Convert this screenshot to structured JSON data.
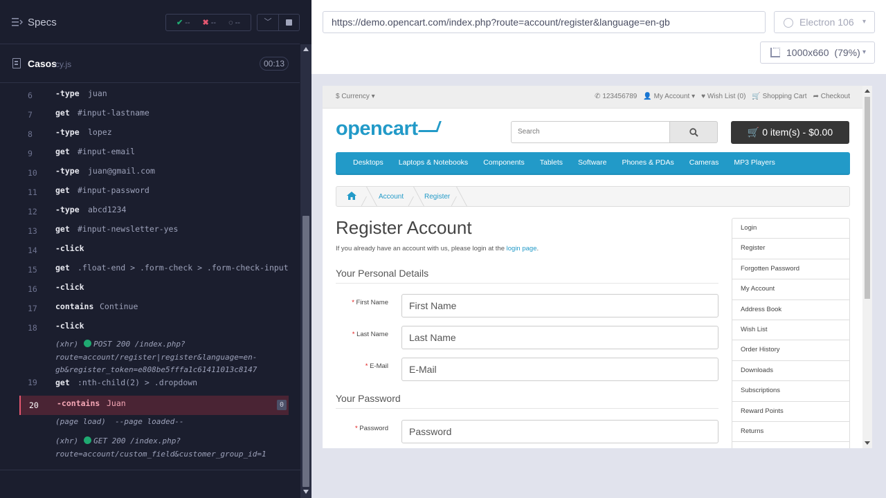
{
  "runner": {
    "specs_label": "Specs",
    "stats": {
      "passed": "--",
      "failed": "--",
      "pending": "--"
    },
    "spec_name": "Casos",
    "spec_ext": "cy.js",
    "timer": "00:13"
  },
  "log": [
    {
      "line": "6",
      "cmd": "-type",
      "arg": "juan"
    },
    {
      "line": "7",
      "cmd": "get",
      "arg": "#input-lastname"
    },
    {
      "line": "8",
      "cmd": "-type",
      "arg": "lopez"
    },
    {
      "line": "9",
      "cmd": "get",
      "arg": "#input-email"
    },
    {
      "line": "10",
      "cmd": "-type",
      "arg": "juan@gmail.com"
    },
    {
      "line": "11",
      "cmd": "get",
      "arg": "#input-password"
    },
    {
      "line": "12",
      "cmd": "-type",
      "arg": "abcd1234"
    },
    {
      "line": "13",
      "cmd": "get",
      "arg": "#input-newsletter-yes"
    },
    {
      "line": "14",
      "cmd": "-click",
      "arg": ""
    },
    {
      "line": "15",
      "cmd": "get",
      "arg": ".float-end > .form-check > .form-check-input"
    },
    {
      "line": "16",
      "cmd": "-click",
      "arg": ""
    },
    {
      "line": "17",
      "cmd": "contains",
      "arg": "Continue"
    },
    {
      "line": "18",
      "cmd": "-click",
      "arg": ""
    }
  ],
  "xhr1": {
    "type": "(xhr)",
    "line1": "POST 200 /index.php?",
    "line2": "route=account/register|register&language=en-",
    "line3": "gb&register_token=e808be5fffa1c61411013c8147"
  },
  "log19": {
    "line": "19",
    "cmd": "get",
    "arg": ":nth-child(2) > .dropdown"
  },
  "log20": {
    "line": "20",
    "cmd": "-contains",
    "arg": "Juan",
    "badge": "0"
  },
  "pageload": {
    "type": "(page load)",
    "text": "--page loaded--"
  },
  "xhr2": {
    "type": "(xhr)",
    "line1": "GET 200 /index.php?",
    "line2": "route=account/custom_field&customer_group_id=1"
  },
  "browser": {
    "url": "https://demo.opencart.com/index.php?route=account/register&language=en-gb",
    "browser_name": "Electron 106",
    "viewport": "1000x660",
    "scale": "(79%)"
  },
  "oc": {
    "currency": "$ Currency",
    "phone": "123456789",
    "my_account": "My Account",
    "wishlist": "Wish List (0)",
    "shopping_cart": "Shopping Cart",
    "checkout": "Checkout",
    "logo": "opencart",
    "search_placeholder": "Search",
    "cart_button": "0 item(s) - $0.00",
    "nav": [
      "Desktops",
      "Laptops & Notebooks",
      "Components",
      "Tablets",
      "Software",
      "Phones & PDAs",
      "Cameras",
      "MP3 Players"
    ],
    "breadcrumb": [
      "Account",
      "Register"
    ],
    "heading": "Register Account",
    "intro_text": "If you already have an account with us, please login at the",
    "intro_link": "login page",
    "intro_end": ".",
    "legend_personal": "Your Personal Details",
    "legend_password": "Your Password",
    "fields": [
      {
        "label": "First Name",
        "placeholder": "First Name"
      },
      {
        "label": "Last Name",
        "placeholder": "Last Name"
      },
      {
        "label": "E-Mail",
        "placeholder": "E-Mail"
      },
      {
        "label": "Password",
        "placeholder": "Password"
      }
    ],
    "required_mark": "*",
    "sidebar": [
      "Login",
      "Register",
      "Forgotten Password",
      "My Account",
      "Address Book",
      "Wish List",
      "Order History",
      "Downloads",
      "Subscriptions",
      "Reward Points",
      "Returns"
    ]
  }
}
